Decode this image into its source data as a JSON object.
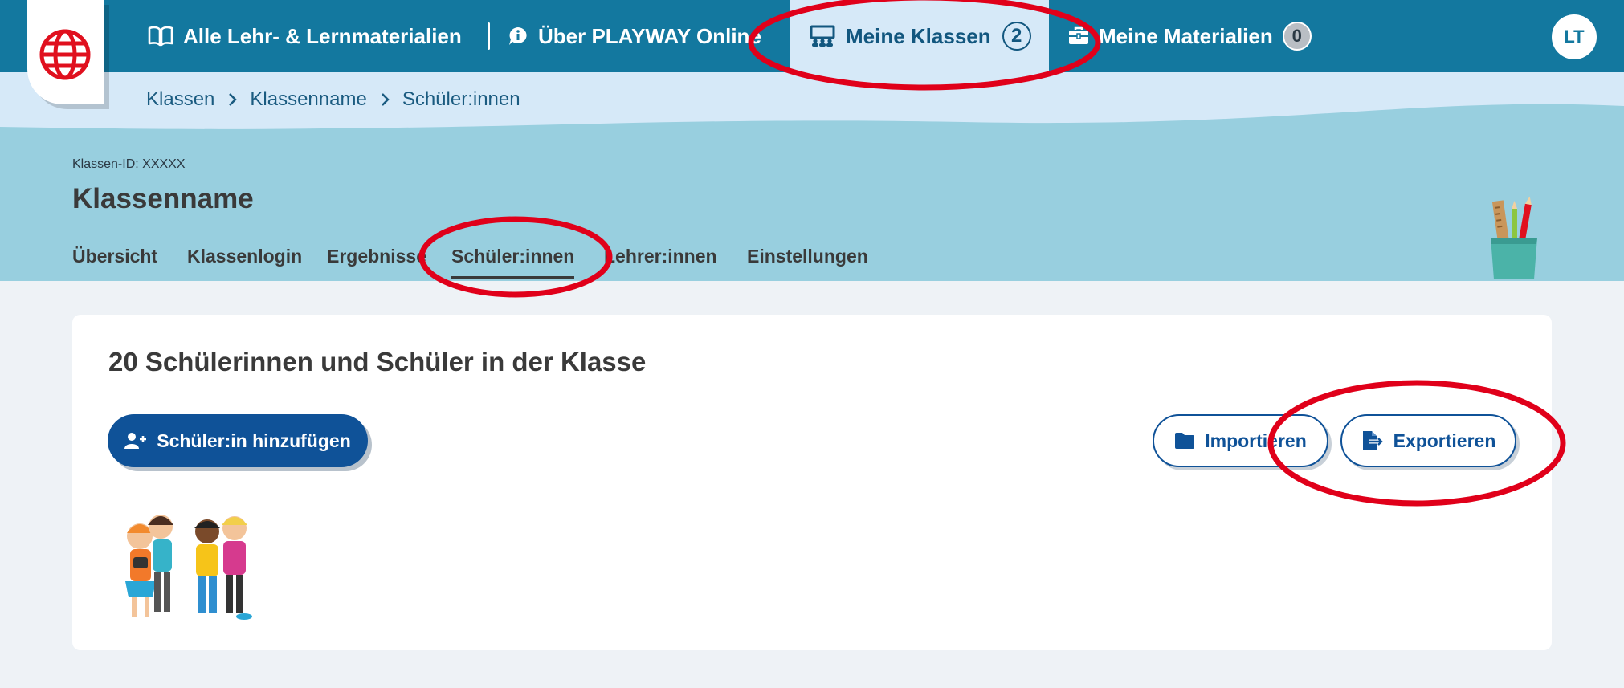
{
  "nav": {
    "all_materials": "Alle Lehr- & Lernmaterialien",
    "about": "Über PLAYWAY Online",
    "my_classes": "Meine Klassen",
    "my_classes_count": "2",
    "my_materials": "Meine Materialien",
    "my_materials_count": "0",
    "avatar_initials": "LT"
  },
  "breadcrumb": [
    "Klassen",
    "Klassenname",
    "Schüler:innen"
  ],
  "class_header": {
    "class_id": "Klassen-ID: XXXXX",
    "class_name": "Klassenname"
  },
  "tabs": [
    {
      "label": "Übersicht"
    },
    {
      "label": "Klassenlogin"
    },
    {
      "label": "Ergebnisse"
    },
    {
      "label": "Schüler:innen",
      "active": true
    },
    {
      "label": "Lehrer:innen"
    },
    {
      "label": "Einstellungen"
    }
  ],
  "card": {
    "title": "20 Schülerinnen und Schüler in der Klasse",
    "add_button": "Schüler:in hinzufügen",
    "import_button": "Importieren",
    "export_button": "Exportieren"
  },
  "colors": {
    "topbar": "#13789f",
    "active_nav": "#d6e9f8",
    "band": "#98cfdf",
    "primary": "#0f5298",
    "annotation": "#e0001a"
  },
  "icons": [
    "globe-logo-icon",
    "book-icon",
    "info-bubble-icon",
    "classroom-icon",
    "briefcase-icon",
    "chevron-right-icon",
    "user-plus-icon",
    "folder-icon",
    "file-export-icon",
    "pencil-cup-icon"
  ]
}
